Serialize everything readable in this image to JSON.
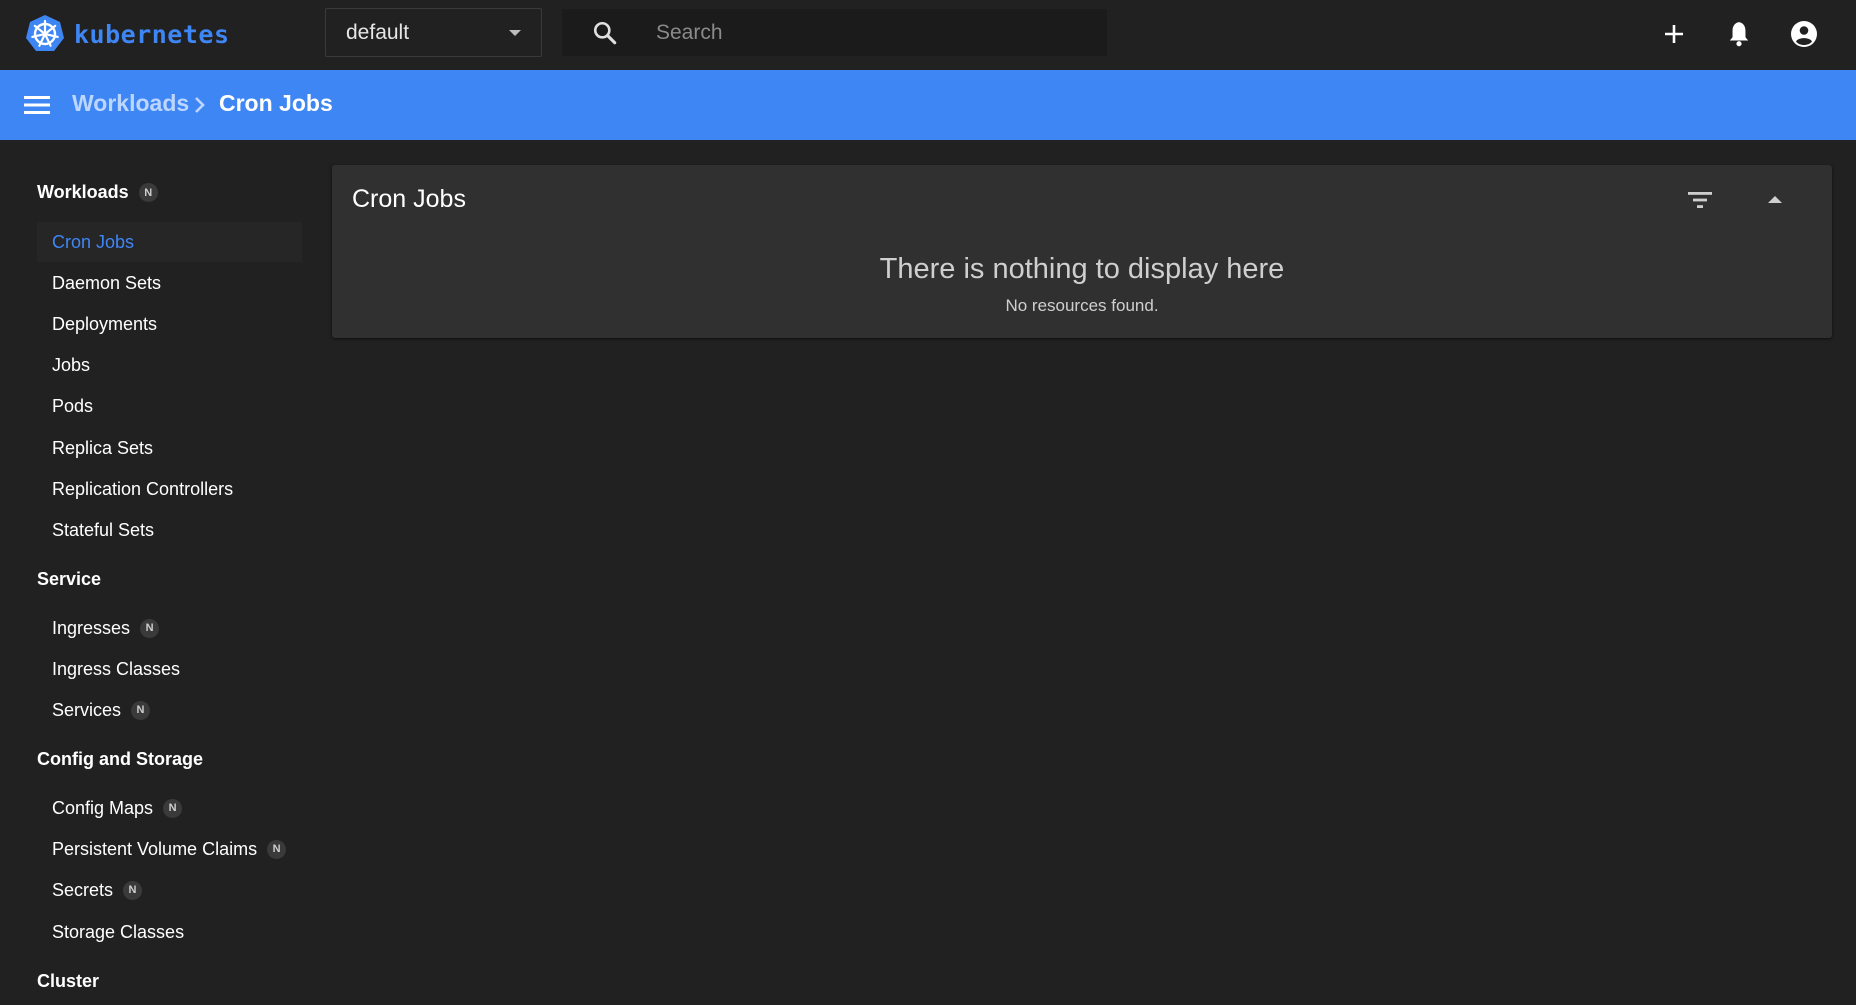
{
  "app": {
    "brand": "kubernetes",
    "colors": {
      "accent": "#3f86f5",
      "background": "#212121",
      "card": "#303030"
    }
  },
  "topbar": {
    "namespace": "default",
    "search_placeholder": "Search",
    "icons": [
      "plus-icon",
      "bell-icon",
      "account-circle-icon"
    ]
  },
  "breadcrumb": {
    "parent": "Workloads",
    "current": "Cron Jobs"
  },
  "sidebar": {
    "new_badge": "N",
    "sections": [
      {
        "title": "Workloads",
        "badge": true,
        "items": [
          {
            "label": "Cron Jobs",
            "active": true
          },
          {
            "label": "Daemon Sets"
          },
          {
            "label": "Deployments"
          },
          {
            "label": "Jobs"
          },
          {
            "label": "Pods"
          },
          {
            "label": "Replica Sets"
          },
          {
            "label": "Replication Controllers"
          },
          {
            "label": "Stateful Sets"
          }
        ]
      },
      {
        "title": "Service",
        "items": [
          {
            "label": "Ingresses",
            "badge": true
          },
          {
            "label": "Ingress Classes"
          },
          {
            "label": "Services",
            "badge": true
          }
        ]
      },
      {
        "title": "Config and Storage",
        "items": [
          {
            "label": "Config Maps",
            "badge": true
          },
          {
            "label": "Persistent Volume Claims",
            "badge": true
          },
          {
            "label": "Secrets",
            "badge": true
          },
          {
            "label": "Storage Classes"
          }
        ]
      },
      {
        "title": "Cluster",
        "items": []
      }
    ]
  },
  "main": {
    "card_title": "Cron Jobs",
    "empty_title": "There is nothing to display here",
    "empty_subtitle": "No resources found."
  }
}
